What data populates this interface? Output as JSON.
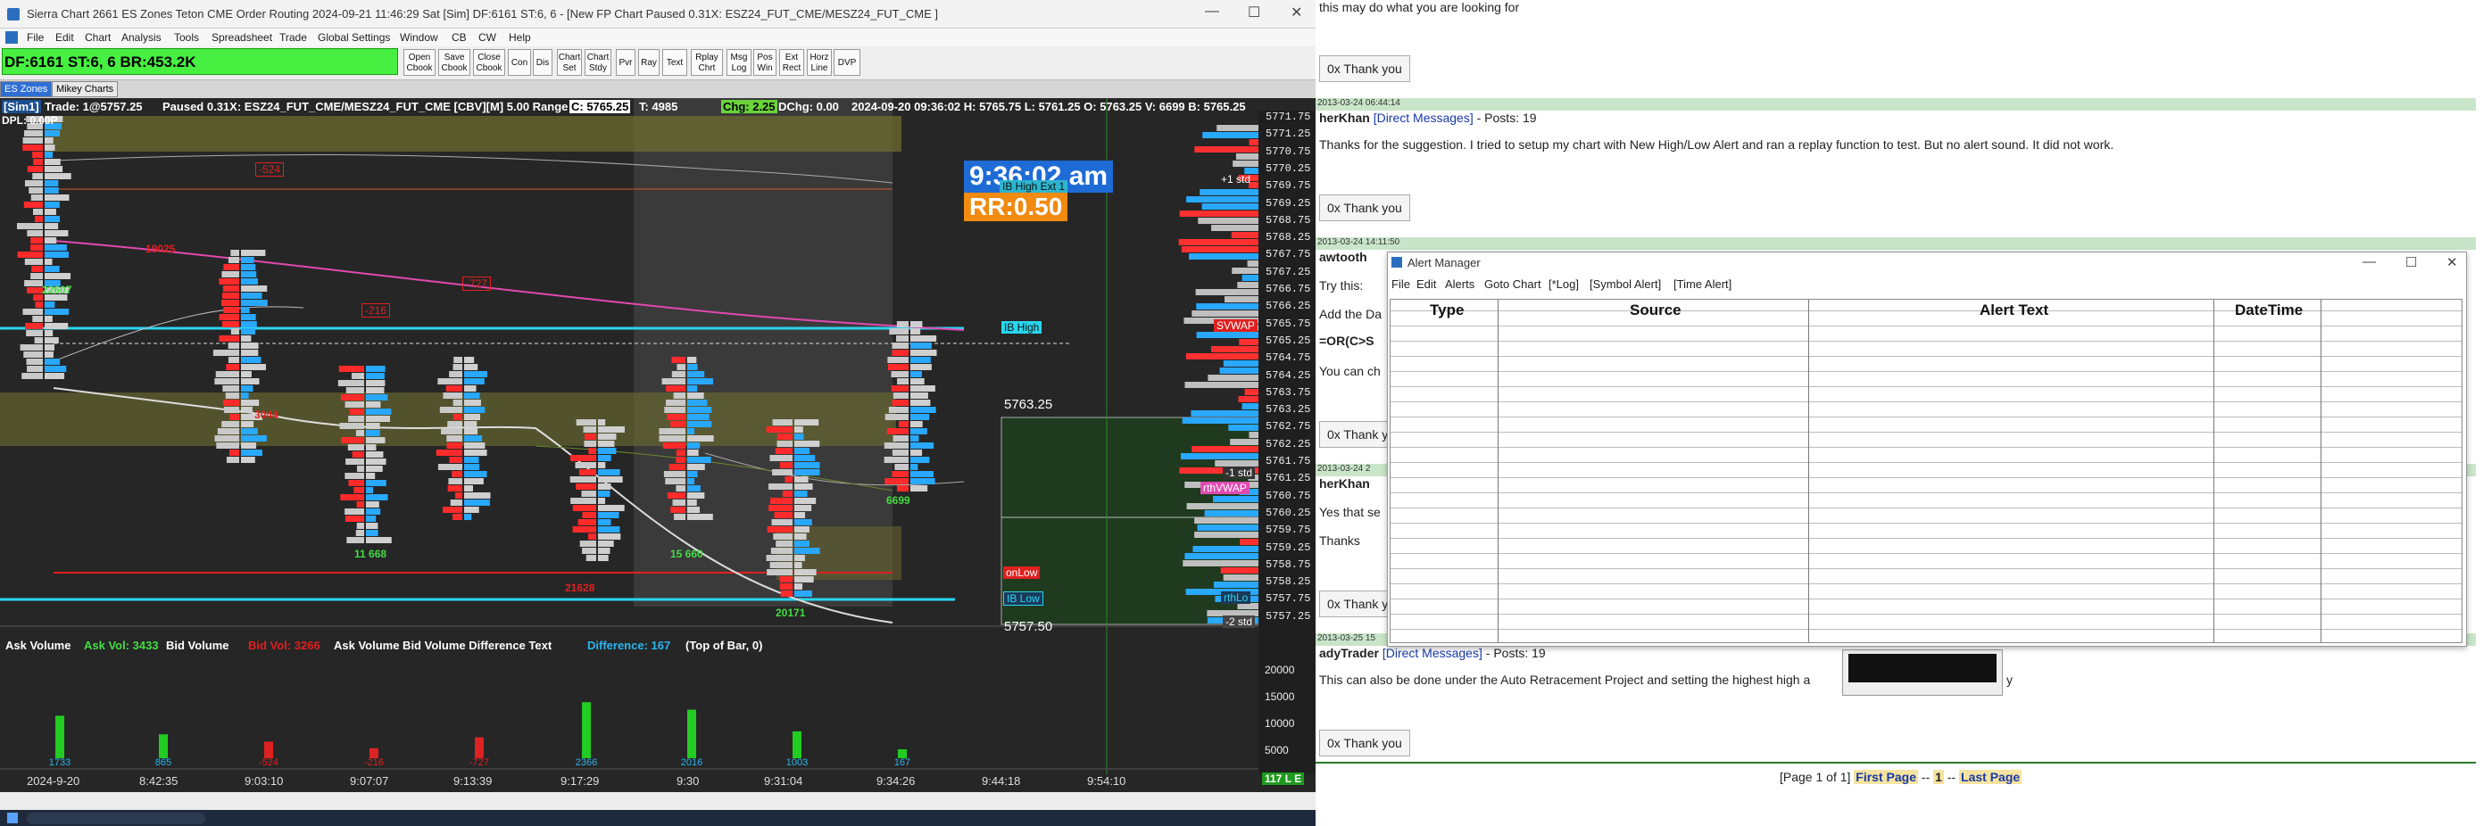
{
  "sierra": {
    "title": "Sierra Chart 2661 ES Zones Teton CME Order Routing 2024-09-21  11:46:29 Sat [Sim] DF:6161  ST:6, 6 - [New FP Chart Paused 0.31X: ESZ24_FUT_CME/MESZ24_FUT_CME ]",
    "menu": [
      "File",
      "Edit",
      "Chart",
      "Analysis",
      "Tools",
      "Spreadsheet",
      "Trade",
      "Global Settings",
      "Window",
      "CB",
      "CW",
      "Help"
    ],
    "status_box": "DF:6161  ST:6, 6  BR:453.2K",
    "toolbar": [
      "Open Cbook",
      "Save Cbook",
      "Close Cbook",
      "Con",
      "Dis",
      "Chart Set",
      "Chart Stdy",
      "Pvr",
      "Ray",
      "Text",
      "Rplay Chrt",
      "Msg Log",
      "Pos Win",
      "Ext Rect",
      "Horz Line",
      "DVP"
    ],
    "tabs": [
      "ES Zones",
      "Mikey Charts"
    ],
    "header_sim": "[Sim1]",
    "header_trade": "Trade: 1@5757.25",
    "header_main": "Paused 0.31X: ESZ24_FUT_CME/MESZ24_FUT_CME [CBV][M]  5.00 Range #5",
    "header_c": "C: 5765.25",
    "header_t": "T: 4985",
    "header_chg": "Chg: 2.25",
    "header_dchg": "DChg: 0.00",
    "header_rest": "2024-09-20 09:36:02  H: 5765.75  L: 5761.25  O: 5763.25  V: 6699  B: 5765.25",
    "dpl": "DPL: 0.00P",
    "clock": "9:36:02 am",
    "rr": "RR:0.50",
    "ib_high_ext": "IB High Ext 1",
    "ib_high": "IB High",
    "ib_low": "IB Low",
    "on_low": "onLow",
    "rth_lo": "rthLo",
    "svwap": "SVWAP",
    "rthvwap": "rthVWAP",
    "plus1std": "+1 std",
    "minus1std": "-1 std",
    "minus2std": "-2 std",
    "box_high": "5763.25",
    "box_low": "5757.50",
    "price_axis": [
      "5771.75",
      "5771.25",
      "5770.75",
      "5770.25",
      "5769.75",
      "5769.25",
      "5768.75",
      "5768.25",
      "5767.75",
      "5767.25",
      "5766.75",
      "5766.25",
      "5765.75",
      "5765.25",
      "5764.75",
      "5764.25",
      "5763.75",
      "5763.25",
      "5762.75",
      "5762.25",
      "5761.75",
      "5761.25",
      "5760.75",
      "5760.25",
      "5759.75",
      "5759.25",
      "5758.75",
      "5758.25",
      "5757.75",
      "5757.25"
    ],
    "vol_labels": [
      "22607",
      "11 668",
      "15 660",
      "20171",
      "6699"
    ],
    "neg_labels": [
      "-524",
      "-727",
      "-216",
      "3044",
      "21628",
      "19025"
    ],
    "delta_boxes": [
      "1733",
      "865",
      "-524",
      "-216",
      "-727",
      "2366",
      "2016",
      "1003",
      "167"
    ],
    "indicator": {
      "ask_volume": "Ask Volume",
      "ask_vol": "Ask Vol: 3433",
      "bid_volume": "Bid Volume",
      "bid_vol": "Bid Vol: 3266",
      "diff_text": "Ask Volume Bid Volume Difference Text",
      "difference": "Difference: 167",
      "top_of_bar": "(Top of Bar, 0)"
    },
    "lower_axis": [
      "20000",
      "15000",
      "10000",
      "5000"
    ],
    "time_axis": [
      "2024-9-20",
      "8:42:35",
      "9:03:10",
      "9:07:07",
      "9:13:39",
      "9:17:29",
      "9:30",
      "9:31:04",
      "9:34:26",
      "9:44:18",
      "9:54:10"
    ],
    "corner": "117 L E",
    "bar_deltas": [
      1733,
      865,
      -524,
      -216,
      -727,
      2366,
      2016,
      1003,
      167
    ],
    "colors": {
      "bg": "#262626",
      "ask": "#22aaff",
      "bid": "#ff2222",
      "vwap": "#e04ab0",
      "cyan": "#29d6f0"
    }
  },
  "forum": {
    "top_text": "this may do what you are looking for",
    "thank_label": "0x Thank you",
    "post1_date": "2013-03-24 06:44:14",
    "post1_user": "herKhan",
    "post1_dm": "[Direct Messages]",
    "post1_posts": " - Posts: 19",
    "post1_text": "Thanks for the suggestion. I tried to setup my chart with New High/Low Alert and ran a replay function to test. But no alert sound. It did not work.",
    "post2_date": "2013-03-24 14:11:50",
    "post2_user": "awtooth",
    "post2_try": "Try this:",
    "post2_add": "Add the Da",
    "post2_formula": "=OR(C>S",
    "post2_youcan": "You can ch",
    "post3_date": "2013-03-24 2",
    "post3_user": "herKhan",
    "post3_text1": "Yes that se",
    "post3_text2": "Thanks",
    "post4_date": "2013-03-25 15",
    "post4_user": "adyTrader",
    "post4_dm": "[Direct Messages]",
    "post4_posts": " - Posts: 19",
    "post4_text": "This can also be done under the Auto Retracement Project and setting the highest high a",
    "post4_tail": "y",
    "pager_text": "[Page 1 of 1]",
    "first_page": "First Page",
    "current_page": "1",
    "last_page": "Last Page",
    "sep": "--"
  },
  "alert_manager": {
    "title": "Alert Manager",
    "menu": [
      "File",
      "Edit",
      "Alerts",
      "Goto Chart",
      "[*Log]",
      "[Symbol Alert]",
      "[Time Alert]"
    ],
    "columns": [
      "Type",
      "Source",
      "Alert Text",
      "DateTime"
    ]
  }
}
